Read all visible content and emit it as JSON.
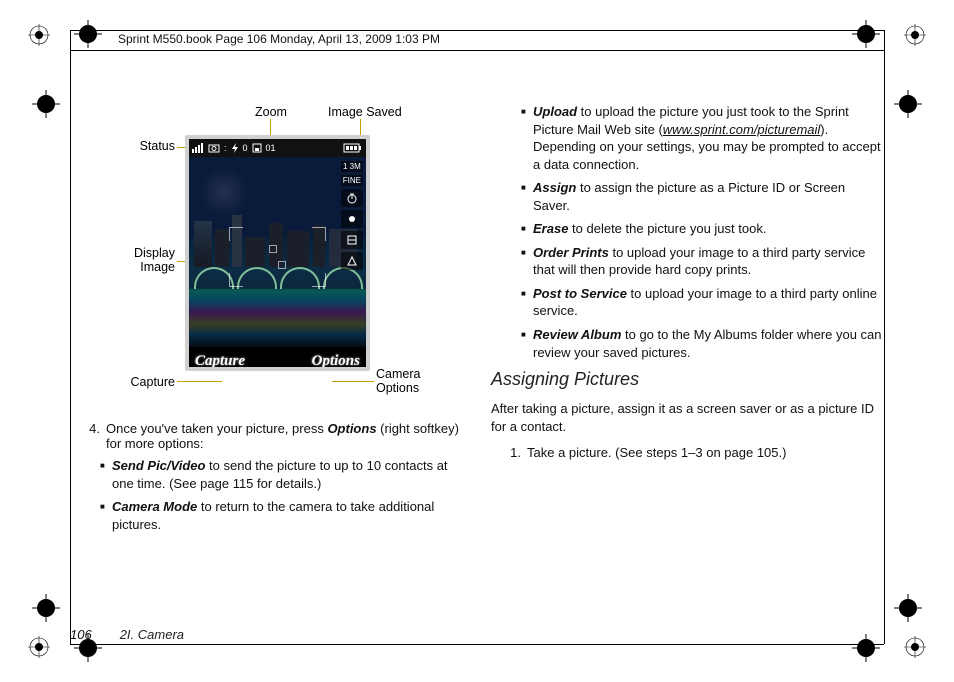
{
  "header": {
    "text": "Sprint M550.book  Page 106  Monday, April 13, 2009  1:03 PM"
  },
  "figure": {
    "callouts": {
      "zoom": "Zoom",
      "image_saved": "Image Saved",
      "status": "Status",
      "display_image_l1": "Display",
      "display_image_l2": "Image",
      "capture": "Capture",
      "camera_options_l1": "Camera",
      "camera_options_l2": "Options"
    },
    "status_icons": {
      "count": "0",
      "index": "01"
    },
    "badges": {
      "res": "1 3M",
      "quality": "FINE"
    },
    "softkeys": {
      "left": "Capture",
      "right": "Options"
    }
  },
  "left_col": {
    "step4_num": "4.",
    "step4_text_a": "Once you've taken your picture, press ",
    "step4_text_b": "Options",
    "step4_text_c": " (right softkey) for more options:",
    "bullets": [
      {
        "term": "Send Pic/Video",
        "rest": " to send the picture to up to 10 contacts at one time. (See page 115 for details.)"
      },
      {
        "term": "Camera Mode",
        "rest": " to return to the camera to take additional pictures."
      }
    ]
  },
  "right_col": {
    "bullets": [
      {
        "term": "Upload",
        "rest_a": " to upload the picture you just took to the Sprint Picture Mail Web site (",
        "link": "www.sprint.com/picturemail",
        "rest_b": "). Depending on your settings, you may be prompted to accept a data connection."
      },
      {
        "term": "Assign",
        "rest": " to assign the picture as a Picture ID or Screen Saver."
      },
      {
        "term": "Erase",
        "rest": " to delete the picture you just took."
      },
      {
        "term": "Order Prints",
        "rest": " to upload your image to a third party service that will then provide hard copy prints."
      },
      {
        "term": "Post to Service",
        "rest": " to upload your image to a third party online service."
      },
      {
        "term": "Review Album",
        "rest": " to go to the My Albums folder where you can review your saved pictures."
      }
    ],
    "section_title": "Assigning Pictures",
    "para": "After taking a picture, assign it as a screen saver or as a picture ID for a contact.",
    "step1_num": "1.",
    "step1_text": "Take a picture. (See steps 1–3 on page 105.)"
  },
  "footer": {
    "page": "106",
    "chapter": "2I. Camera"
  }
}
